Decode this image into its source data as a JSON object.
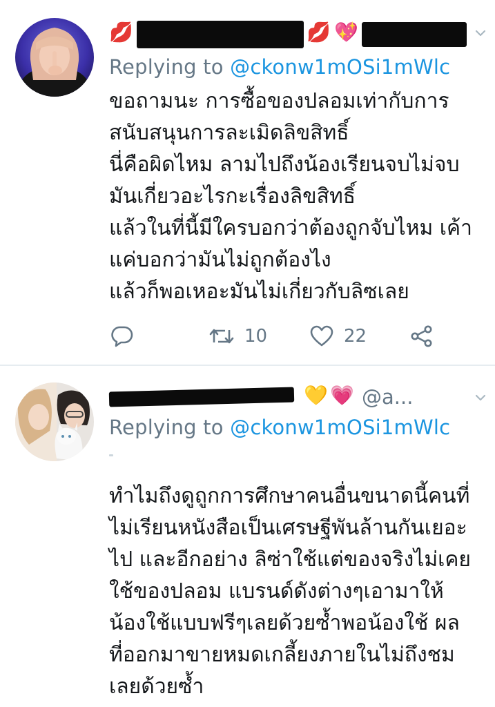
{
  "tweets": [
    {
      "emoji_left": "💋",
      "emoji_right": [
        "💋",
        "💖"
      ],
      "reply_prefix": "Replying to",
      "reply_to": "@ckonw1mOSi1mWlc",
      "text_lines": [
        "ขอถามนะ การซื้อของปลอมเท่ากับการ",
        "สนับสนุนการละเมิดลิขสิทธิ์",
        "นี่คือผิดไหม ลามไปถึงน้องเรียนจบไม่จบ",
        "มันเกี่ยวอะไรกะเรื่องลิขสิทธิ์",
        "แล้วในที่นี้มีใครบอกว่าต้องถูกจับไหม เค้า",
        "แค่บอกว่ามันไม่ถูกต้องไง",
        "แล้วก็พอเหอะมันไม่เกี่ยวกับลิซเลย"
      ],
      "actions": {
        "reply_icon": "comment-icon",
        "retweet_icon": "retweet-icon",
        "retweet_count": "10",
        "like_icon": "heart-icon",
        "like_count": "22",
        "share_icon": "share-icon"
      }
    },
    {
      "emoji_right": [
        "💛",
        "💗"
      ],
      "handle": "@a...",
      "reply_prefix": "Replying to",
      "reply_to": "@ckonw1mOSi1mWlc",
      "text_lines": [
        "ทำไมถึงดูถูกการศึกษาคนอื่นขนาดนี้คนที่",
        "ไม่เรียนหนังสือเป็นเศรษฐีพันล้านกันเยอะ",
        "ไป และอีกอย่าง ลิซ่าใช้แต่ของจริงไม่เคย",
        "ใช้ของปลอม แบรนด์ดังต่างๆเอามาให้",
        "น้องใช้แบบฟรีๆเลยด้วยซ้ำพอน้องใช้ ผล",
        "ที่ออกมาขายหมดเกลี้ยงภายในไม่ถึงชม",
        "เลยด้วยซ้ำ"
      ]
    }
  ],
  "colors": {
    "link": "#1b95e0",
    "secondary": "#657786",
    "text": "#14171a",
    "divider": "#e6ecf0"
  }
}
